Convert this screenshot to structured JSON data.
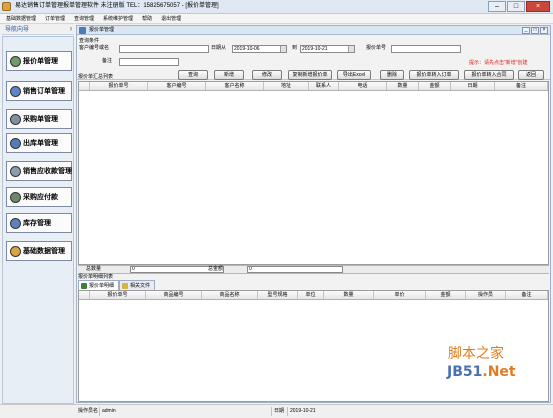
{
  "window": {
    "title": "易达销售订单管理报单管理软件 未注册版 TEL：15825675057 - [报价单管理]",
    "buttons": [
      "–",
      "□",
      "×"
    ]
  },
  "menu": [
    "基础数据管理",
    "订单管理",
    "查询管理",
    "系统维护管理",
    "帮助",
    "退出管理"
  ],
  "nav": {
    "header": "导航向导",
    "pin": "ᵡ",
    "items": [
      "报价单管理",
      "销售订单管理",
      "采购单管理",
      "出库单管理",
      "销售应收款管理",
      "采购应付款",
      "库存管理",
      "基础数据管理"
    ]
  },
  "child": {
    "title": "报价单管理",
    "buttons": [
      "_",
      "□",
      "×"
    ]
  },
  "query": {
    "group": "查询条件",
    "customer_label": "客户编号或名",
    "customer_value": "",
    "date_from_label": "日期从",
    "date_from": "2019-10-06",
    "date_to_label": "到",
    "date_to": "2019-10-21",
    "quote_no_label": "报价单号",
    "quote_no_value": "",
    "remark_label": "备注",
    "remark_value": "",
    "hint": "提示：请先点击\"新增\"创建",
    "buttons": [
      "查询",
      "新增",
      "修改",
      "复制新增报价单",
      "导出Excel",
      "删除",
      "报价单转入订单",
      "报价单转入合同",
      "返回"
    ]
  },
  "summary_grid": {
    "title": "报价单汇总列表",
    "columns": [
      "报价单号",
      "客户编号",
      "客户名称",
      "地址",
      "联系人",
      "电话",
      "数量",
      "金额",
      "日期",
      "备注"
    ]
  },
  "totals": {
    "qty_label": "总数量",
    "qty_value": "0",
    "amount_label": "总金额",
    "amount_value": "0"
  },
  "detail": {
    "title": "报价单明细列表",
    "tabs": [
      "报价单明细",
      "相关文件"
    ],
    "columns": [
      "报价单号",
      "商品编号",
      "商品名称",
      "型号规格",
      "单位",
      "数量",
      "单价",
      "金额",
      "操作员",
      "备注"
    ]
  },
  "status": {
    "operator_label": "操作员名",
    "operator": "admin",
    "date_label": "日期",
    "date": "2019-10-21"
  },
  "watermark": {
    "line1": "脚本之家",
    "line2a": "JB51",
    "line2b": ".Net"
  },
  "colors": {
    "accent": "#1f4e9c",
    "hint_red": "#e0201b",
    "watermark_orange": "#e07c1f",
    "watermark_blue": "#4b6fb5"
  }
}
